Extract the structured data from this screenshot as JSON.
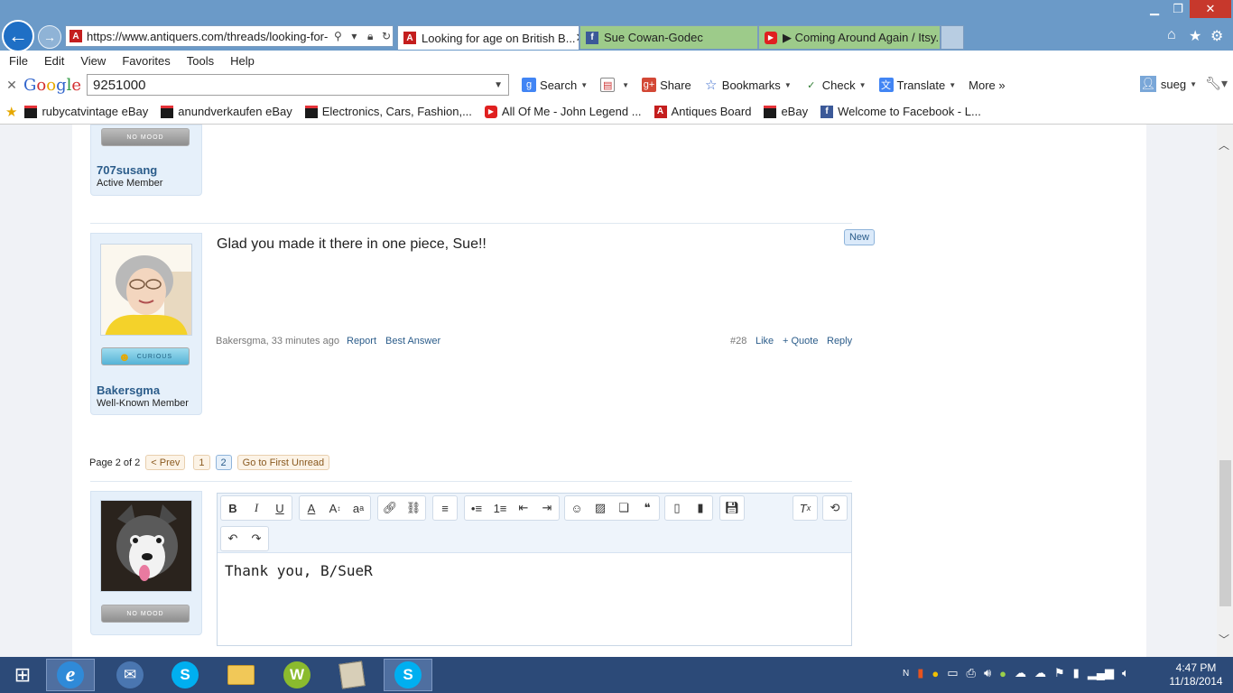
{
  "browser": {
    "address_url": "https://www.antiquers.com/threads/looking-for-ag",
    "tabs": [
      {
        "title": "Looking for age on British B..."
      },
      {
        "title": "Sue Cowan-Godec"
      },
      {
        "title": "▶ Coming Around Again / Itsy..."
      }
    ],
    "menu": [
      "File",
      "Edit",
      "View",
      "Favorites",
      "Tools",
      "Help"
    ]
  },
  "google_toolbar": {
    "logo": "Google",
    "search_value": "9251000",
    "search_label": "Search",
    "share_label": "Share",
    "bookmarks_label": "Bookmarks",
    "check_label": "Check",
    "translate_label": "Translate",
    "more_label": "More »",
    "user": "sueg"
  },
  "favorites": [
    {
      "label": "rubycatvintage  eBay",
      "icon": "ebay-icon"
    },
    {
      "label": "anundverkaufen  eBay",
      "icon": "ebay-icon"
    },
    {
      "label": "Electronics, Cars, Fashion,...",
      "icon": "ebay-icon"
    },
    {
      "label": "All Of Me - John Legend ...",
      "icon": "youtube-icon"
    },
    {
      "label": "Antiques Board",
      "icon": "antiquers-icon"
    },
    {
      "label": "eBay",
      "icon": "ebay-icon"
    },
    {
      "label": "Welcome to Facebook - L...",
      "icon": "facebook-icon"
    }
  ],
  "posts": [
    {
      "username": "707susang",
      "user_title": "Active Member",
      "mood": "NO MOOD"
    },
    {
      "username": "Bakersgma",
      "user_title": "Well-Known Member",
      "mood": "CURIOUS",
      "message": "Glad you made it there in one piece, Sue!!",
      "badge": "New",
      "meta": "Bakersgma, 33 minutes ago",
      "report": "Report",
      "best_answer": "Best Answer",
      "number": "#28",
      "like": "Like",
      "quote": "+ Quote",
      "reply": "Reply"
    }
  ],
  "pagination": {
    "label": "Page 2 of 2",
    "prev": "< Prev",
    "pages": [
      "1",
      "2"
    ],
    "current": "2",
    "first_unread": "Go to First Unread"
  },
  "reply_box": {
    "mood": "NO MOOD",
    "text": "Thank you, B/SueR"
  },
  "taskbar": {
    "time": "4:47 PM",
    "date": "11/18/2014"
  }
}
